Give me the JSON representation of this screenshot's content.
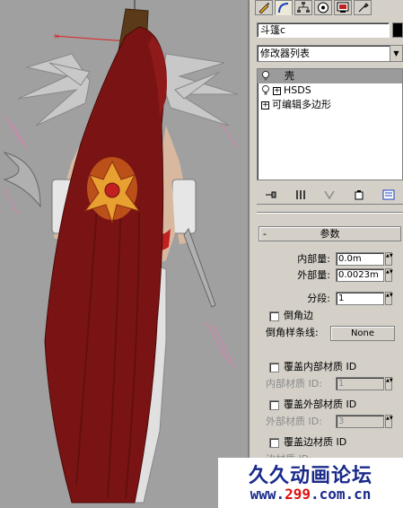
{
  "viewport": {
    "label": "character-with-red-cape"
  },
  "panel": {
    "tabs": [
      "create",
      "modify",
      "hierarchy",
      "motion",
      "display",
      "utilities"
    ],
    "object_name": "斗篷c",
    "color_swatch": "#000000",
    "modifier_list_label": "修改器列表",
    "stack": [
      {
        "label": "壳",
        "selected": true,
        "has_bulb": true,
        "has_plus": false
      },
      {
        "label": "HSDS",
        "selected": false,
        "has_bulb": true,
        "has_plus": true
      },
      {
        "label": "可编辑多边形",
        "selected": false,
        "has_bulb": false,
        "has_plus": true
      }
    ],
    "stack_tools": [
      "pin-stack",
      "show-end-result",
      "make-unique",
      "remove-modifier",
      "configure-modifier-sets"
    ],
    "rollout": {
      "toggle": "-",
      "title": "参数",
      "inner_amount_label": "内部量:",
      "inner_amount_value": "0.0m",
      "outer_amount_label": "外部量:",
      "outer_amount_value": "0.0023m",
      "segments_label": "分段:",
      "segments_value": "1",
      "bevel_edges_label": "倒角边",
      "bevel_spline_label": "倒角样条线:",
      "bevel_spline_value": "None",
      "override_inner_label": "覆盖内部材质 ID",
      "inner_mat_label": "内部材质 ID:",
      "inner_mat_value": "1",
      "override_outer_label": "覆盖外部材质 ID",
      "outer_mat_label": "外部材质 ID:",
      "outer_mat_value": "3",
      "override_edge_label": "覆盖边材质 ID",
      "edge_mat_label": "边材质 ID:"
    }
  },
  "watermark": {
    "title": "久久动画论坛",
    "url_prefix": "www.",
    "url_highlight": "299",
    "url_suffix": ".com.cn"
  }
}
